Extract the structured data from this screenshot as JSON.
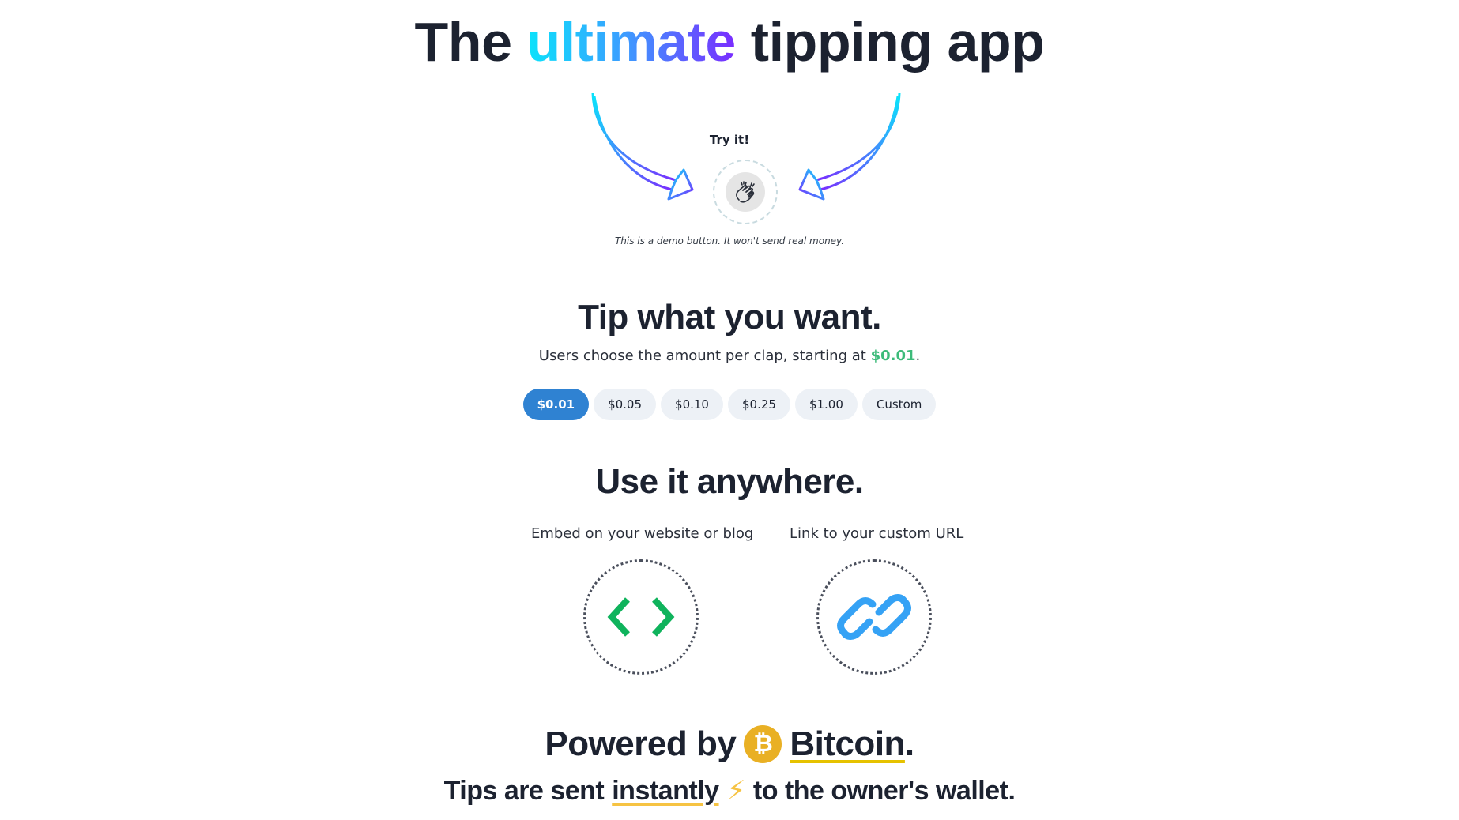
{
  "hero": {
    "title_before": "The",
    "title_highlight": "ultimate",
    "title_after": "tipping app",
    "gradient_colors": [
      "#0be3fb",
      "#3aa0ff",
      "#7a2cff"
    ]
  },
  "demo": {
    "try_label": "Try it!",
    "clap_icon": "clapping-hands-icon",
    "note": "This is a demo button. It won't send real money."
  },
  "tip_section": {
    "heading": "Tip what you want.",
    "subtitle_before": "Users choose the amount per clap, starting at",
    "subtitle_amount": "$0.01",
    "subtitle_after": ".",
    "accent_color": "#3dbb7a",
    "amounts": [
      {
        "label": "$0.01",
        "selected": true
      },
      {
        "label": "$0.05",
        "selected": false
      },
      {
        "label": "$0.10",
        "selected": false
      },
      {
        "label": "$0.25",
        "selected": false
      },
      {
        "label": "$1.00",
        "selected": false
      },
      {
        "label": "Custom",
        "selected": false
      }
    ],
    "selected_color": "#2f82d2"
  },
  "anywhere_section": {
    "heading": "Use it anywhere.",
    "options": [
      {
        "label": "Embed on your website or blog",
        "icon": "code-brackets-icon",
        "color": "#0fb35c"
      },
      {
        "label": "Link to your custom URL",
        "icon": "link-chain-icon",
        "color": "#35a2f5"
      }
    ]
  },
  "powered_section": {
    "powered_by": "Powered by",
    "coin_symbol": "₿",
    "coin_icon": "bitcoin-icon",
    "bitcoin": "Bitcoin",
    "period": ".",
    "tagline_before": "Tips are sent",
    "tagline_emphasis": "instantly",
    "lightning_icon": "⚡",
    "tagline_after": "to the owner's wallet."
  }
}
